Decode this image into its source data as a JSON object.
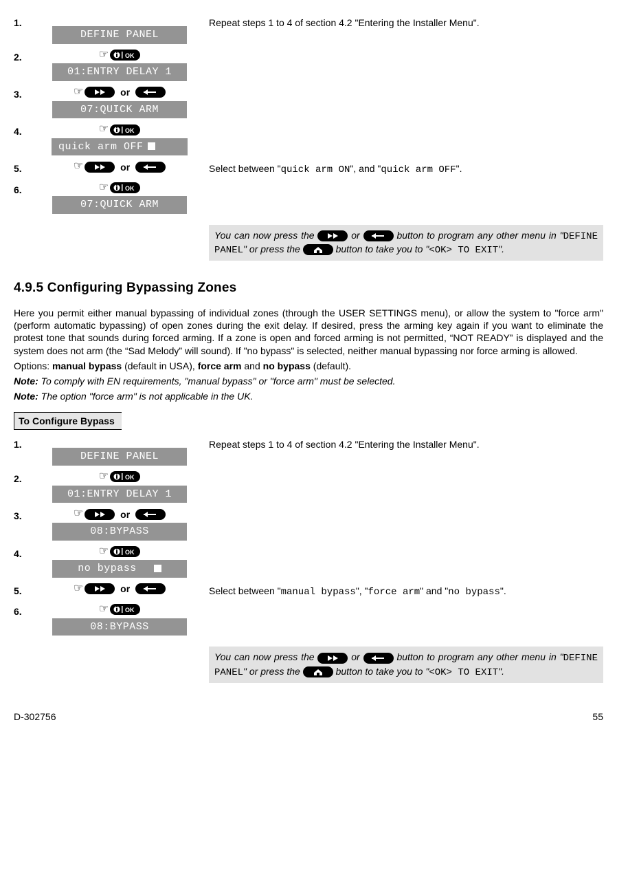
{
  "sectionA": {
    "intro": "Repeat steps 1 to 4 of section 4.2 \"Entering the Installer Menu\".",
    "steps": {
      "s1": {
        "num": "1.",
        "lcd": "DEFINE PANEL"
      },
      "s2": {
        "num": "2.",
        "lcd": "01:ENTRY DELAY 1"
      },
      "s3": {
        "num": "3.",
        "or": "or",
        "lcd": "07:QUICK ARM"
      },
      "s4": {
        "num": "4.",
        "lcd": "quick arm OFF"
      },
      "s5": {
        "num": "5.",
        "or": "or",
        "desc_pre": "Select between \"",
        "opt1": "quick arm ON",
        "mid": "\", and \"",
        "opt2": "quick arm OFF",
        "end": "\"."
      },
      "s6": {
        "num": "6.",
        "lcd": "07:QUICK ARM"
      }
    },
    "tip": {
      "t1": "You can now press the ",
      "t2": " or ",
      "t3": " button to program any other menu in \"",
      "menu": "DEFINE PANEL",
      "t4": "\" or press the ",
      "t5": " button to take you to \"",
      "exit": "<OK> TO EXIT",
      "t6": "\"."
    }
  },
  "heading": "4.9.5 Configuring Bypassing Zones",
  "body": {
    "p1": "Here you permit either manual bypassing of individual zones (through the USER SETTINGS menu), or allow the system to \"force arm\" (perform automatic bypassing) of open zones during the exit delay. If desired, press the arming key again if you want to eliminate the protest tone that sounds during forced arming. If a zone is open and forced arming is not permitted, “NOT READY” is displayed and the system does not arm (the “Sad Melody” will sound). If \"no bypass\" is selected, neither manual bypassing nor force arming is allowed.",
    "p2_a": "Options: ",
    "p2_b1": "manual bypass",
    "p2_m1": " (default in USA), ",
    "p2_b2": "force arm",
    "p2_m2": " and ",
    "p2_b3": "no bypass",
    "p2_m3": " (default).",
    "n1_label": "Note:",
    "n1_text": " To comply with EN requirements, \"manual bypass\" or \"force arm\" must be selected.",
    "n2_label": "Note:",
    "n2_text": " The option \"force arm\" is not applicable in the UK."
  },
  "sectionLabel": "To Configure Bypass",
  "sectionB": {
    "intro": "Repeat steps 1 to 4 of section 4.2 \"Entering the Installer Menu\".",
    "steps": {
      "s1": {
        "num": "1.",
        "lcd": "DEFINE PANEL"
      },
      "s2": {
        "num": "2.",
        "lcd": "01:ENTRY DELAY 1"
      },
      "s3": {
        "num": "3.",
        "or": "or",
        "lcd": "08:BYPASS"
      },
      "s4": {
        "num": "4.",
        "lcd": "no bypass"
      },
      "s5": {
        "num": "5.",
        "or": "or",
        "desc_pre": "Select between \"",
        "opt1": "manual bypass",
        "mid1": "\", \"",
        "opt2": "force arm",
        "mid2": "\" and \"",
        "opt3": "no bypass",
        "end": "\"."
      },
      "s6": {
        "num": "6.",
        "lcd": "08:BYPASS"
      }
    },
    "tip": {
      "t1": "You can now press the ",
      "t2": " or ",
      "t3": " button to program any other menu in \"",
      "menu": "DEFINE PANEL",
      "t4": "\" or press the ",
      "t5": " button to take you to \"",
      "exit": "<OK> TO EXIT",
      "t6": "\"."
    }
  },
  "footer": {
    "left": "D-302756",
    "right": "55"
  },
  "icons": {
    "ok": "ℹ︎ | OK"
  }
}
